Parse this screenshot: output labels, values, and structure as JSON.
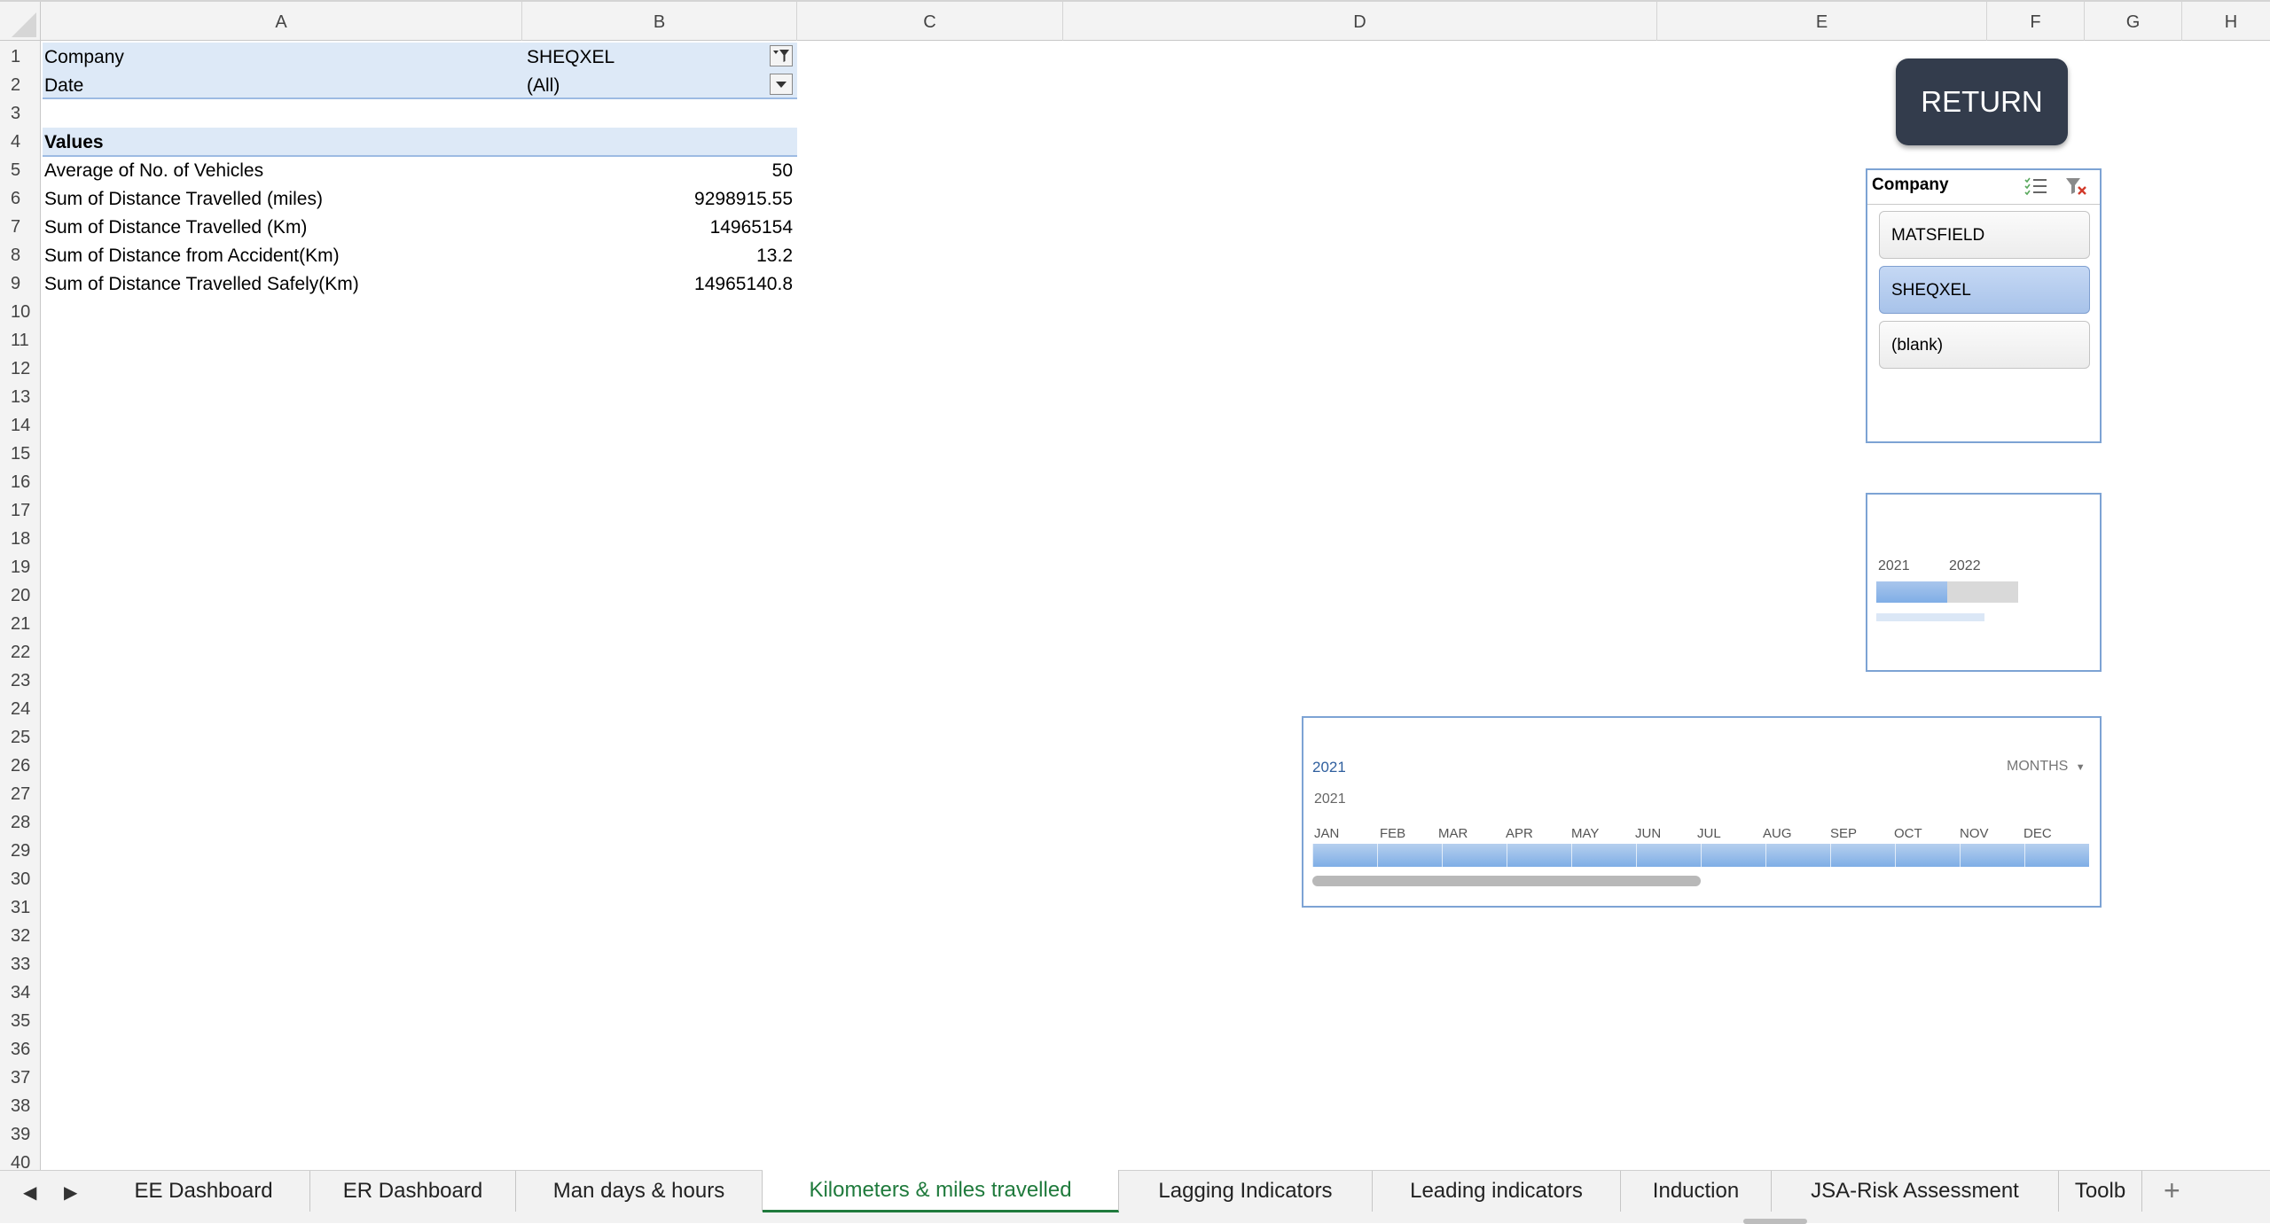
{
  "columns": [
    "A",
    "B",
    "C",
    "D",
    "E",
    "F",
    "G",
    "H"
  ],
  "rows": [
    "1",
    "2",
    "3",
    "4",
    "5",
    "6",
    "7",
    "8",
    "9",
    "10",
    "11",
    "12",
    "13",
    "14",
    "15",
    "16",
    "17",
    "18",
    "19",
    "20",
    "21",
    "22",
    "23",
    "24",
    "25",
    "26",
    "27",
    "28",
    "29",
    "30",
    "31",
    "32",
    "33",
    "34",
    "35",
    "36",
    "37",
    "38",
    "39",
    "40"
  ],
  "pivot": {
    "filters": [
      {
        "label": "Company",
        "value": "SHEQXEL"
      },
      {
        "label": "Date",
        "value": "(All)"
      }
    ],
    "values_header": "Values",
    "rows": [
      {
        "label": "Average of No. of Vehicles",
        "value": "50"
      },
      {
        "label": "Sum of Distance Travelled (miles)",
        "value": "9298915.55"
      },
      {
        "label": "Sum of Distance Travelled (Km)",
        "value": "14965154"
      },
      {
        "label": "Sum of Distance from Accident(Km)",
        "value": "13.2"
      },
      {
        "label": "Sum of Distance Travelled Safely(Km)",
        "value": "14965140.8"
      }
    ]
  },
  "return_button": {
    "label": "RETURN"
  },
  "company_slicer": {
    "title": "Company",
    "items": [
      {
        "label": "MATSFIELD",
        "selected": false
      },
      {
        "label": "SHEQXEL",
        "selected": true
      },
      {
        "label": "(blank)",
        "selected": false
      }
    ]
  },
  "year_timeline": {
    "years": [
      "2021",
      "2022"
    ]
  },
  "date_timeline": {
    "selection_label": "2021",
    "level": "MONTHS",
    "year_label": "2021",
    "months": [
      "JAN",
      "FEB",
      "MAR",
      "APR",
      "MAY",
      "JUN",
      "JUL",
      "AUG",
      "SEP",
      "OCT",
      "NOV",
      "DEC"
    ]
  },
  "sheet_tabs": [
    {
      "label": "EE Dashboard",
      "active": false
    },
    {
      "label": "ER Dashboard",
      "active": false
    },
    {
      "label": "Man days & hours",
      "active": false
    },
    {
      "label": "Kilometers & miles travelled",
      "active": true
    },
    {
      "label": "Lagging Indicators",
      "active": false
    },
    {
      "label": "Leading indicators",
      "active": false
    },
    {
      "label": "Induction",
      "active": false
    },
    {
      "label": "JSA-Risk Assessment",
      "active": false
    },
    {
      "label": "Toolb",
      "active": false
    }
  ],
  "colors": {
    "accent_green": "#1f7a3c",
    "pivot_band": "#dde9f7",
    "slicer_selected": "#b5cdf0",
    "button_dark": "#333c4c"
  }
}
